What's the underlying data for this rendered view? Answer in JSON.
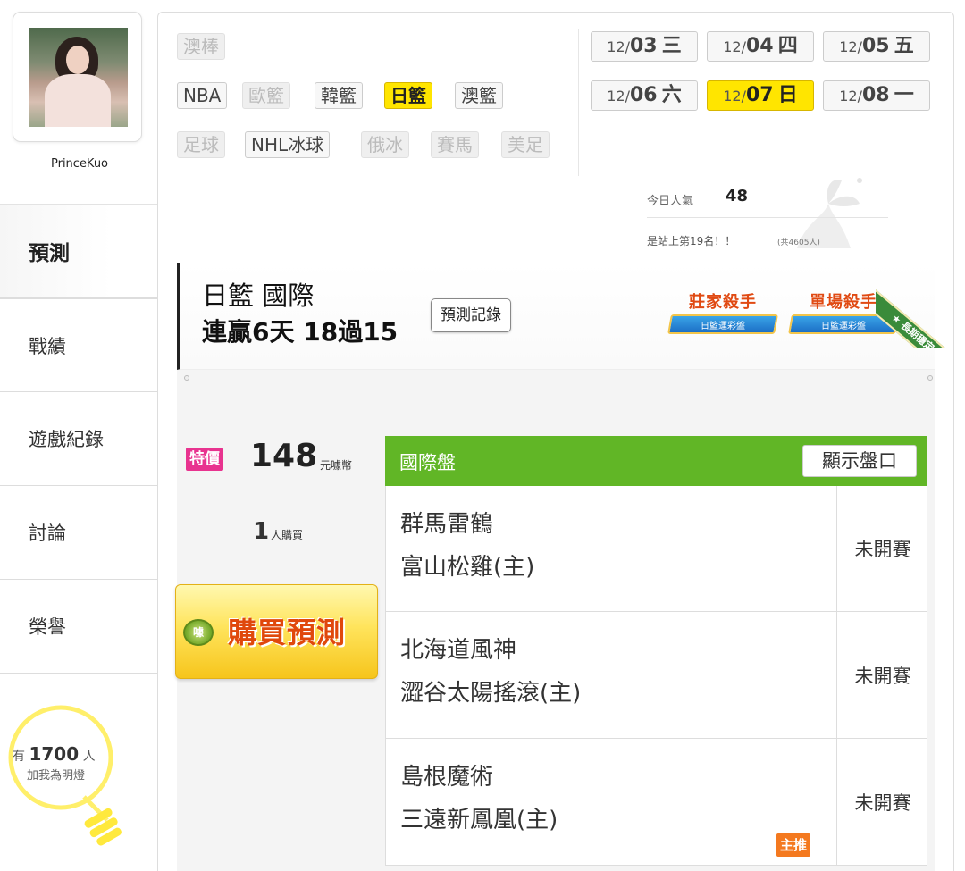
{
  "user": {
    "username": "PrinceKuo"
  },
  "nav": [
    {
      "label": "預測",
      "active": true
    },
    {
      "label": "戰績",
      "active": false
    },
    {
      "label": "遊戲紀錄",
      "active": false
    },
    {
      "label": "討論",
      "active": false
    },
    {
      "label": "榮譽",
      "active": false
    }
  ],
  "fans": {
    "prefix": "有",
    "count": "1700",
    "suffix": "人",
    "cta": "加我為明燈"
  },
  "sports": {
    "row1": [
      {
        "label": "澳棒",
        "state": "dim"
      }
    ],
    "row2": [
      {
        "label": "NBA",
        "state": "normal"
      },
      {
        "label": "歐籃",
        "state": "dim"
      },
      {
        "label": "韓籃",
        "state": "normal"
      },
      {
        "label": "日籃",
        "state": "highlight"
      },
      {
        "label": "澳籃",
        "state": "normal"
      }
    ],
    "row3": [
      {
        "label": "足球",
        "state": "dim"
      },
      {
        "label": "NHL冰球",
        "state": "normal"
      },
      {
        "label": "俄冰",
        "state": "dim"
      },
      {
        "label": "賽馬",
        "state": "dim"
      },
      {
        "label": "美足",
        "state": "dim"
      }
    ]
  },
  "dates": [
    {
      "md": "12/",
      "d": "03",
      "dow": "三",
      "selected": false
    },
    {
      "md": "12/",
      "d": "04",
      "dow": "四",
      "selected": false
    },
    {
      "md": "12/",
      "d": "05",
      "dow": "五",
      "selected": false
    },
    {
      "md": "12/",
      "d": "06",
      "dow": "六",
      "selected": false
    },
    {
      "md": "12/",
      "d": "07",
      "dow": "日",
      "selected": true
    },
    {
      "md": "12/",
      "d": "08",
      "dow": "一",
      "selected": false
    }
  ],
  "popularity": {
    "label": "今日人氣",
    "value": "48",
    "rank_text": "是站上第19名！！",
    "rank_sub": "(共4605人)"
  },
  "headline": {
    "category": "日籃 國際",
    "streak": "連贏6天 18過15",
    "record_button": "預測記錄"
  },
  "badges": [
    {
      "title": "莊家殺手",
      "ribbon": "日籃運彩盤"
    },
    {
      "title": "單場殺手",
      "ribbon": "日籃運彩盤"
    }
  ],
  "corner_ribbon": "★ 長期穩定 ★",
  "offer": {
    "special_label": "特價",
    "price": "148",
    "unit": "元噱幣",
    "buyers": "1",
    "buyers_label": "人購買",
    "buy_button": "購買預測",
    "coin_label": "噱"
  },
  "games": {
    "header": "國際盤",
    "show_odds": "顯示盤口",
    "rows": [
      {
        "away": "群馬雷鶴",
        "home": "富山松雞(主)",
        "status": "未開賽",
        "recommended": false
      },
      {
        "away": "北海道風神",
        "home": "澀谷太陽搖滾(主)",
        "status": "未開賽",
        "recommended": false
      },
      {
        "away": "島根魔術",
        "home": "三遠新鳳凰(主)",
        "status": "未開賽",
        "recommended": true,
        "rec_label": "主推"
      }
    ]
  },
  "colors": {
    "highlight": "#ffe500",
    "green_header": "#61b626",
    "special": "#e8338f",
    "recommend": "#f4791f",
    "buy_text": "#e0480c"
  }
}
